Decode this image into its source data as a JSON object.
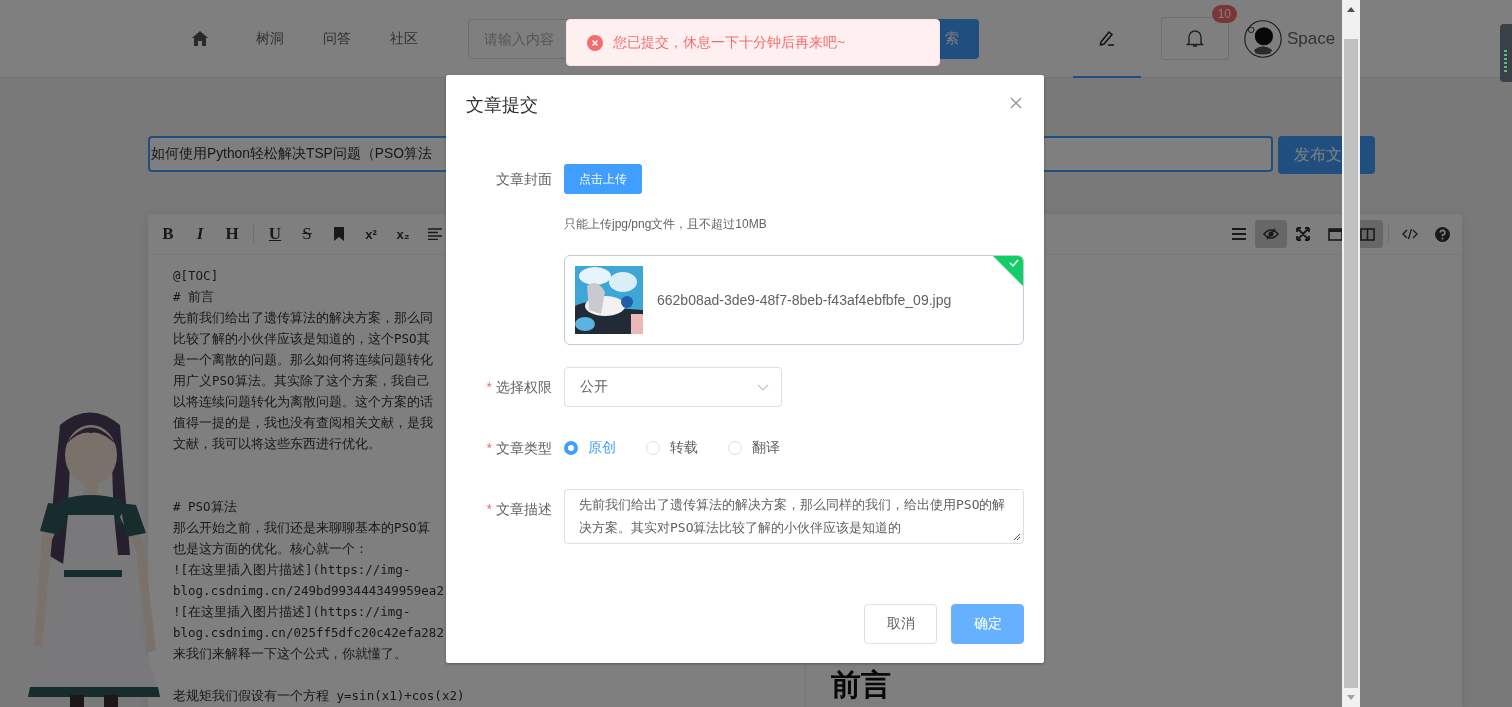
{
  "header": {
    "nav": [
      {
        "kind": "home"
      },
      {
        "kind": "link",
        "label": "树洞"
      },
      {
        "kind": "link",
        "label": "问答"
      },
      {
        "kind": "link",
        "label": "社区"
      }
    ],
    "search": {
      "placeholder": "请输入内容",
      "button": "索"
    },
    "tabs": [
      {
        "kind": "write",
        "selected": true
      },
      {
        "kind": "notifications",
        "selected": false,
        "badge": "10"
      }
    ],
    "user": {
      "name": "Space"
    }
  },
  "editor": {
    "title_value": "如何使用Python轻松解决TSP问题（PSO算法",
    "publish_button": "发布文",
    "toolbar_left": [
      {
        "kind": "bold",
        "glyph": "B"
      },
      {
        "kind": "italic",
        "glyph": "I"
      },
      {
        "kind": "heading",
        "glyph": "H"
      },
      {
        "kind": "underline",
        "glyph": "U"
      },
      {
        "kind": "strike",
        "glyph": "S"
      },
      {
        "kind": "bookmark"
      },
      {
        "kind": "superscript",
        "glyph": "x²"
      },
      {
        "kind": "subscript",
        "glyph": "x₂"
      },
      {
        "kind": "align"
      }
    ],
    "toolbar_right": [
      {
        "kind": "menu",
        "selected": false
      },
      {
        "kind": "preview",
        "selected": true
      },
      {
        "kind": "fullscreen",
        "selected": false
      },
      {
        "kind": "window",
        "selected": false
      },
      {
        "kind": "split",
        "selected": true
      },
      {
        "kind": "code",
        "selected": false
      },
      {
        "kind": "help",
        "selected": false
      }
    ],
    "lines": [
      {
        "kind": "text",
        "text": "@[TOC]"
      },
      {
        "kind": "text",
        "text": "# 前言"
      },
      {
        "kind": "text",
        "text": "先前我们给出了遗传算法的解决方案，那么同"
      },
      {
        "kind": "text",
        "text": "比较了解的小伙伴应该是知道的，这个PSO其"
      },
      {
        "kind": "text",
        "text": "是一个离散的问题。那么如何将连续问题转化"
      },
      {
        "kind": "text",
        "text": "用广义PSO算法。其实除了这个方案，我自己"
      },
      {
        "kind": "text",
        "text": "以将连续问题转化为离散问题。这个方案的话"
      },
      {
        "kind": "text",
        "text": "值得一提的是，我也没有查阅相关文献，是我"
      },
      {
        "kind": "text",
        "text": "文献，我可以将这些东西进行优化。"
      },
      {
        "kind": "blank"
      },
      {
        "kind": "blank"
      },
      {
        "kind": "text",
        "text": "# PSO算法"
      },
      {
        "kind": "text",
        "text": "那么开始之前，我们还是来聊聊基本的PSO算"
      },
      {
        "kind": "text",
        "text": "也是这方面的优化。核心就一个："
      },
      {
        "kind": "text",
        "text": "![在这里插入图片描述](https://img-"
      },
      {
        "kind": "text",
        "text": "blog.csdnimg.cn/249bd993444349959ea2"
      },
      {
        "kind": "text",
        "text": "![在这里插入图片描述](https://img-"
      },
      {
        "kind": "text",
        "text": "blog.csdnimg.cn/025ff5dfc20c42efa282"
      },
      {
        "kind": "text",
        "text": "来我们来解释一下这个公式，你就懂了。"
      },
      {
        "kind": "blank"
      },
      {
        "kind": "text",
        "text": "老规矩我们假设有一个方程 y=sin(x1)+cos(x2)"
      }
    ],
    "preview_heading": "前言"
  },
  "toast": {
    "message": "您已提交，休息一下十分钟后再来吧~"
  },
  "dialog": {
    "title": "文章提交",
    "cover": {
      "label": "文章封面",
      "button": "点击上传",
      "hint": "只能上传jpg/png文件，且不超过10MB",
      "file": {
        "name": "662b08ad-3de9-48f7-8beb-f43af4ebfbfe_09.jpg",
        "uploaded": true
      }
    },
    "permission": {
      "required_mark": "*",
      "label": "选择权限",
      "value": "公开"
    },
    "type": {
      "required_mark": "*",
      "label": "文章类型",
      "options": [
        {
          "label": "原创",
          "selected": true
        },
        {
          "label": "转载",
          "selected": false
        },
        {
          "label": "翻译",
          "selected": false
        }
      ]
    },
    "description": {
      "required_mark": "*",
      "label": "文章描述",
      "value": "先前我们给出了遗传算法的解决方案，那么同样的我们，给出使用PSO的解决方案。其实对PSO算法比较了解的小伙伴应该是知道的"
    },
    "buttons": [
      {
        "kind": "cancel",
        "label": "取消"
      },
      {
        "kind": "confirm",
        "label": "确定"
      }
    ]
  }
}
